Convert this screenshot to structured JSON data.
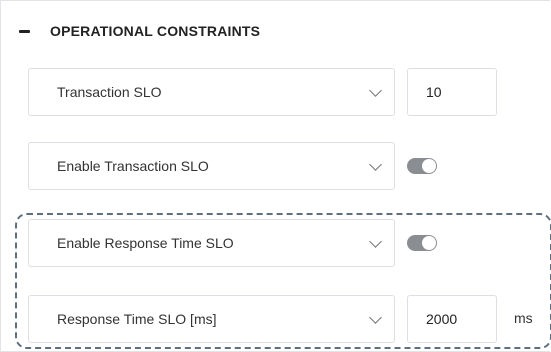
{
  "section": {
    "title": "OPERATIONAL CONSTRAINTS",
    "collapse_symbol": "−"
  },
  "rows": {
    "transaction_slo": {
      "label": "Transaction SLO",
      "value": "10"
    },
    "enable_transaction_slo": {
      "label": "Enable Transaction SLO",
      "toggle_on": true
    },
    "enable_response_time_slo": {
      "label": "Enable Response Time SLO",
      "toggle_on": true
    },
    "response_time_slo": {
      "label": "Response Time SLO [ms]",
      "value": "2000",
      "unit": "ms"
    }
  },
  "colors": {
    "dashed_border": "#5f6f7f",
    "toggle": "#8a8d91",
    "field_border": "#dcdfe3"
  }
}
